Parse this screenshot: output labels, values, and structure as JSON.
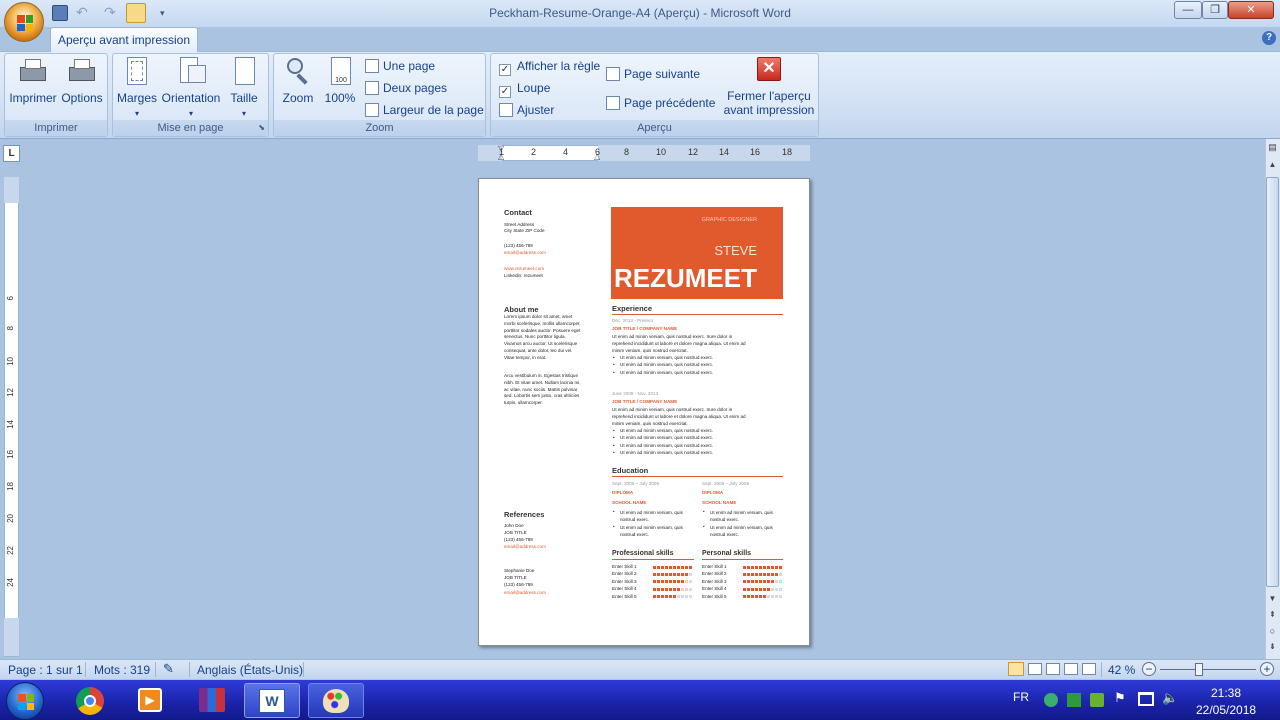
{
  "window": {
    "title": "Peckham-Resume-Orange-A4 (Aperçu) - Microsoft Word",
    "controls": {
      "minimize": "—",
      "maximize": "❐",
      "close": "✕"
    }
  },
  "ribbon": {
    "active_tab": "Aperçu avant impression",
    "groups": {
      "imprimer": {
        "label": "Imprimer",
        "print": "Imprimer",
        "options": "Options"
      },
      "mise_en_page": {
        "label": "Mise en page",
        "margins": "Marges",
        "orientation": "Orientation",
        "size": "Taille"
      },
      "zoom": {
        "label": "Zoom",
        "zoom": "Zoom",
        "hundred": "100%",
        "one_page": "Une page",
        "two_pages": "Deux pages",
        "page_width": "Largeur de la page"
      },
      "apercu": {
        "label": "Aperçu",
        "show_ruler": "Afficher la règle",
        "magnifier": "Loupe",
        "fit": "Ajuster",
        "next_page": "Page suivante",
        "prev_page": "Page précédente",
        "close": "Fermer l'aperçu avant impression",
        "close_l1": "Fermer l'aperçu",
        "close_l2": "avant impression"
      }
    }
  },
  "ruler": {
    "h_ticks": [
      "1",
      "2",
      "4",
      "6",
      "8",
      "10",
      "12",
      "14",
      "16",
      "18"
    ],
    "v_ticks": [
      "6",
      "8",
      "10",
      "12",
      "14",
      "16",
      "18",
      "20",
      "22",
      "24"
    ],
    "corner": "L"
  },
  "document": {
    "contact": {
      "heading": "Contact",
      "lines": [
        "Street Address",
        "City State ZIP Code"
      ],
      "phone": "(123) 456-789",
      "email": "email@address.com",
      "web": "www.rezumeet.com",
      "linkedin": "Linkedin: rezumeet"
    },
    "about": {
      "heading": "About me",
      "p1": [
        "Lorem ipsum dolor sit amet, amet",
        "morbi scelerisque, mollis ullamcorper,",
        "porttitor sodales auctor. Posuere eget",
        "senectus. Nunc porttitor ligula.",
        "Vivamus arcu auctor. Ut scelerisque",
        "consequat, ante dolor, leo dui vel.",
        "Vitae tempor, in erat."
      ],
      "p2": [
        "Arcu vestibulum in. Egestas tristique",
        "nibh. Et vitae amet. Nullam lacinia mi,",
        "ac vitae, nunc sociis. Mattis pulvinar",
        "sed. Lobortis sem justo, cras ultricies",
        "turpis, ullamcorper."
      ]
    },
    "references": {
      "heading": "References",
      "r1": {
        "name": "John Doe",
        "title": "JOB TITLE",
        "phone": "(123) 456-789",
        "email": "email@address.com"
      },
      "r2": {
        "name": "Stephanie Doe",
        "title": "JOB TITLE",
        "phone": "(123) 456-789",
        "email": "email@address.com"
      }
    },
    "banner": {
      "role": "GRAPHIC DESIGNER",
      "first": "STEVE",
      "last": "REZUMEET"
    },
    "experience": {
      "heading": "Experience",
      "jobs": [
        {
          "date": "Dec. 2013 - Present",
          "title": "JOB TITLE / COMPANY NAME",
          "desc": [
            "Ut enim ad minim veniam, quis nostrud exerc. Irure dolor in",
            "reprehend incididunt ut labore et dolore magna aliqua. Ut enim ad",
            "minim veniam, quis nostrud exercitat."
          ],
          "bullets": [
            "Ut enim ad minim veniam, quis nostrud exerc.",
            "Ut enim ad minim veniam, quis nostrud exerc.",
            "Ut enim ad minim veniam, quis nostrud exerc."
          ]
        },
        {
          "date": "June 2008 - Nov. 2013",
          "title": "JOB TITLE / COMPANY NAME",
          "desc": [
            "Ut enim ad minim veniam, quis nostrud exerc. Irure dolor in",
            "reprehend incididunt ut labore et dolore magna aliqua. Ut enim ad",
            "minim veniam, quis nostrud exercitat."
          ],
          "bullets": [
            "Ut enim ad minim veniam, quis nostrud exerc.",
            "Ut enim ad minim veniam, quis nostrud exerc.",
            "Ut enim ad minim veniam, quis nostrud exerc.",
            "Ut enim ad minim veniam, quis nostrud exerc."
          ]
        }
      ]
    },
    "education": {
      "heading": "Education",
      "items": [
        {
          "date": "Sept. 2008 – July 2009",
          "diploma": "DIPLOMA",
          "school": "SCHOOL NAME",
          "bullets": [
            "Ut enim ad minim veniam, quis nostrud exerc.",
            "Ut enim ad minim veniam, quis nostrud exerc."
          ]
        },
        {
          "date": "Sept. 2008 – July 2009",
          "diploma": "DIPLOMA",
          "school": "SCHOOL NAME",
          "bullets": [
            "Ut enim ad minim veniam, quis nostrud exerc.",
            "Ut enim ad minim veniam, quis nostrud exerc."
          ]
        }
      ]
    },
    "pro_skills": {
      "heading": "Professional skills",
      "items": [
        {
          "name": "Enter Skill 1",
          "level": 1.0
        },
        {
          "name": "Enter Skill 2",
          "level": 0.9
        },
        {
          "name": "Enter Skill 3",
          "level": 0.8
        },
        {
          "name": "Enter Skill 4",
          "level": 0.7
        },
        {
          "name": "Enter Skill 5",
          "level": 0.6
        }
      ]
    },
    "personal_skills": {
      "heading": "Personal skills",
      "items": [
        {
          "name": "Enter Skill 1",
          "level": 1.0
        },
        {
          "name": "Enter Skill 2",
          "level": 0.9
        },
        {
          "name": "Enter Skill 3",
          "level": 0.8
        },
        {
          "name": "Enter Skill 4",
          "level": 0.7
        },
        {
          "name": "Enter Skill 5",
          "level": 0.6
        }
      ]
    }
  },
  "status": {
    "page": "Page : 1 sur 1",
    "words": "Mots : 319",
    "language": "Anglais (États-Unis)",
    "zoom": "42 %",
    "zoom_level": 0.42
  },
  "taskbar": {
    "lang": "FR",
    "time": "21:38",
    "date": "22/05/2018"
  },
  "colors": {
    "accent": "#e05a2e",
    "ribbon": "#dbe8f7",
    "taskbar": "#1a22a8"
  }
}
